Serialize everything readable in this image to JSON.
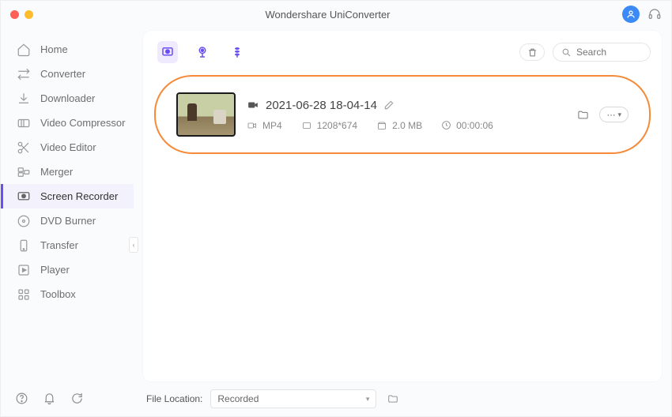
{
  "app": {
    "title": "Wondershare UniConverter"
  },
  "sidebar": {
    "items": [
      {
        "label": "Home"
      },
      {
        "label": "Converter"
      },
      {
        "label": "Downloader"
      },
      {
        "label": "Video Compressor"
      },
      {
        "label": "Video Editor"
      },
      {
        "label": "Merger"
      },
      {
        "label": "Screen Recorder"
      },
      {
        "label": "DVD Burner"
      },
      {
        "label": "Transfer"
      },
      {
        "label": "Player"
      },
      {
        "label": "Toolbox"
      }
    ]
  },
  "search": {
    "placeholder": "Search"
  },
  "recording": {
    "title": "2021-06-28 18-04-14",
    "format": "MP4",
    "resolution": "1208*674",
    "size": "2.0 MB",
    "duration": "00:00:06"
  },
  "footer": {
    "label": "File Location:",
    "selected": "Recorded"
  }
}
